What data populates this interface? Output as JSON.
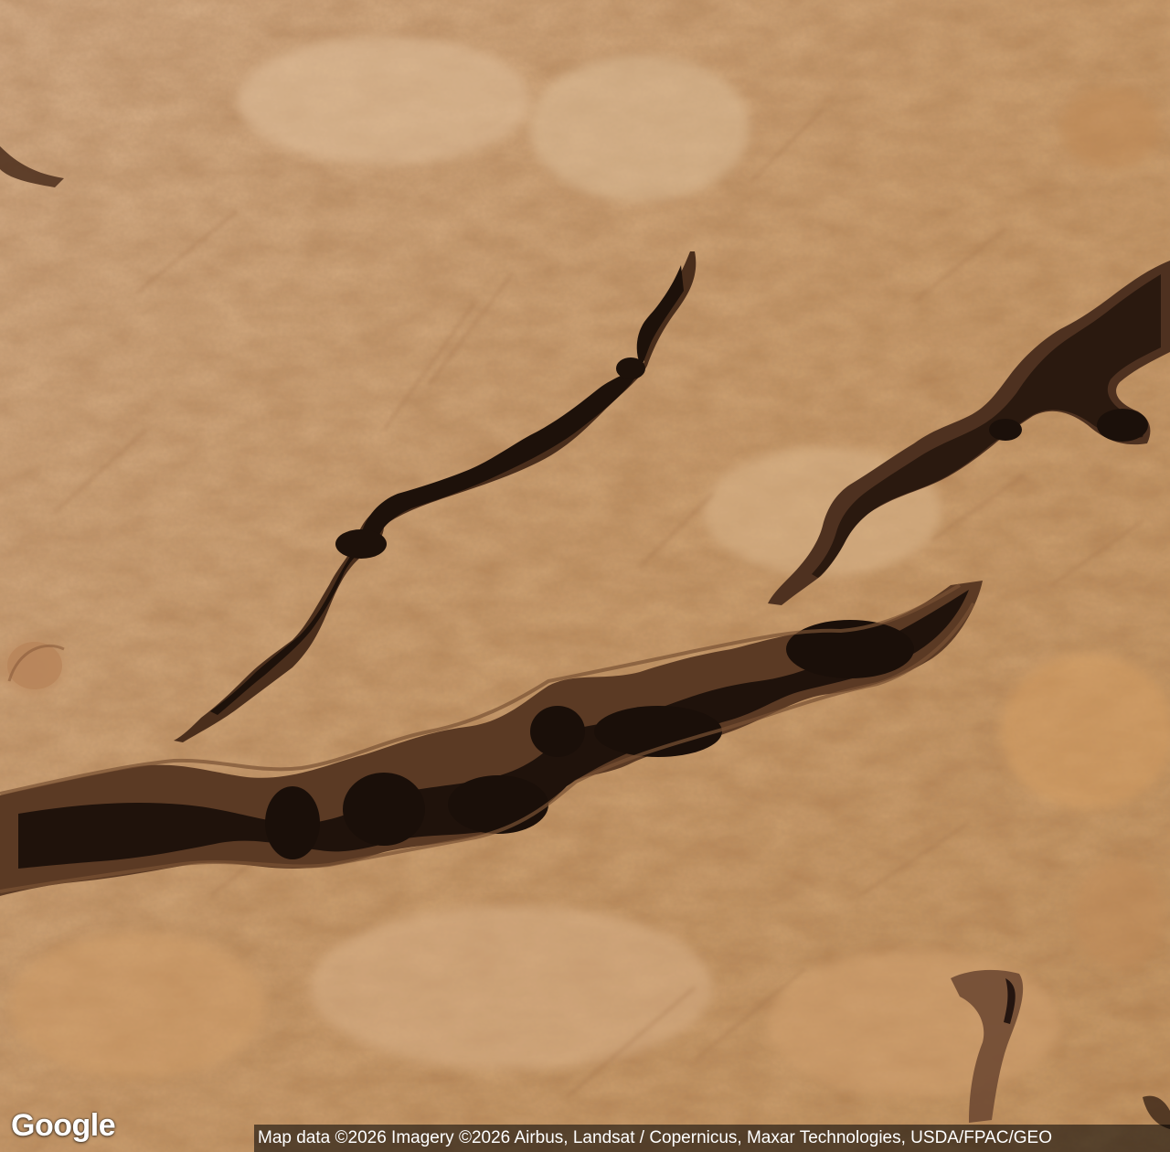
{
  "map": {
    "view": "satellite",
    "logo": "Google",
    "attribution": "Map data ©2026 Imagery ©2026 Airbus, Landsat / Copernicus, Maxar Technologies, USDA/FPAC/GEO",
    "colors": {
      "terrain_light": "#d8b185",
      "terrain_mid": "#c99a66",
      "terrain_dark": "#a8744a",
      "canyon_shadow": "#1f120b",
      "canyon_wall": "#5b3a24"
    }
  }
}
